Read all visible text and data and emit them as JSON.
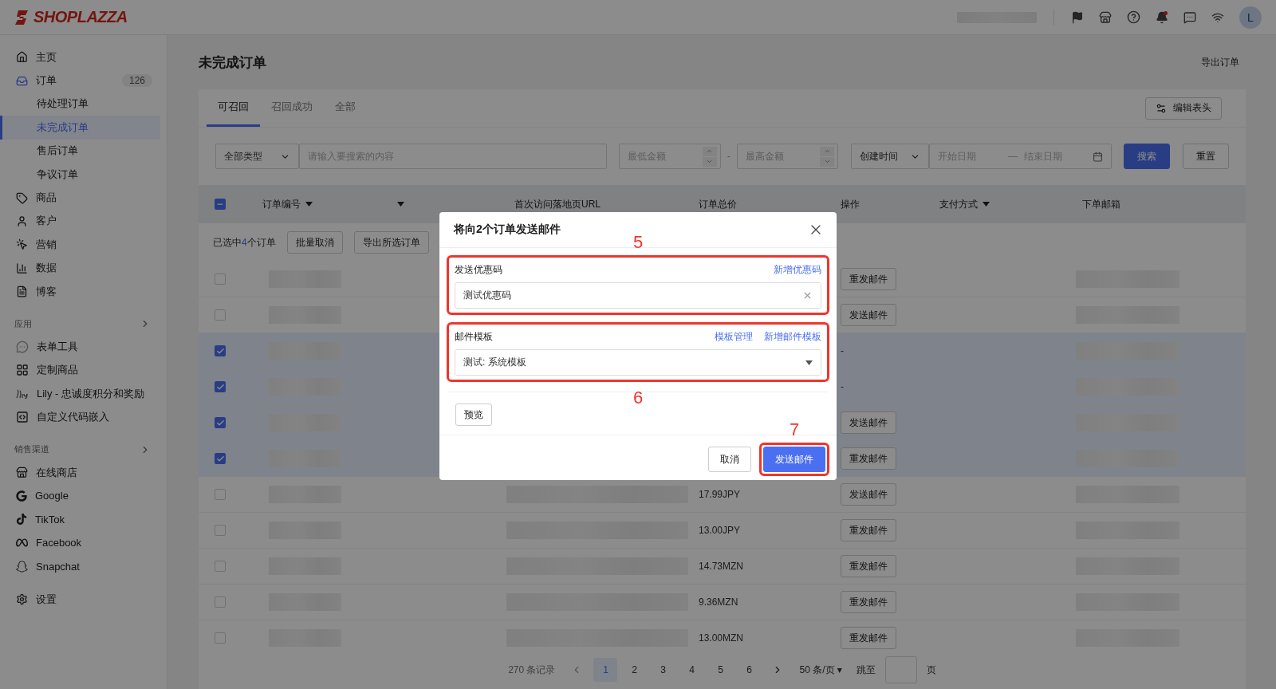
{
  "topbar": {
    "logo": "SHOPLAZZA",
    "avatar": "L"
  },
  "sidebar": {
    "items": [
      {
        "label": "主页",
        "kind": "home",
        "selected": false
      },
      {
        "label": "订单",
        "kind": "orders",
        "badge": "126",
        "selected": false,
        "children": [
          {
            "label": "待处理订单",
            "selected": false
          },
          {
            "label": "未完成订单",
            "selected": true
          },
          {
            "label": "售后订单",
            "selected": false
          },
          {
            "label": "争议订单",
            "selected": false
          }
        ]
      },
      {
        "label": "商品",
        "kind": "products",
        "selected": false
      },
      {
        "label": "客户",
        "kind": "customers",
        "selected": false
      },
      {
        "label": "营销",
        "kind": "marketing",
        "selected": false
      },
      {
        "label": "数据",
        "kind": "analytics",
        "selected": false
      },
      {
        "label": "博客",
        "kind": "blog",
        "selected": false
      }
    ],
    "sections": [
      {
        "title": "应用",
        "items": [
          {
            "label": "表单工具",
            "kind": "form",
            "selected": false
          },
          {
            "label": "定制商品",
            "kind": "custom",
            "selected": false
          },
          {
            "label": "Lily - 忠诚度积分和奖励",
            "kind": "lily",
            "selected": false
          },
          {
            "label": "自定义代码嵌入",
            "kind": "code",
            "selected": false
          }
        ]
      },
      {
        "title": "销售渠道",
        "items": [
          {
            "label": "在线商店",
            "kind": "store",
            "selected": false
          },
          {
            "label": "Google",
            "kind": "google",
            "selected": false
          },
          {
            "label": "TikTok",
            "kind": "tiktok",
            "selected": false
          },
          {
            "label": "Facebook",
            "kind": "facebook",
            "selected": false
          },
          {
            "label": "Snapchat",
            "kind": "snapchat",
            "selected": false
          }
        ]
      }
    ],
    "settings": {
      "label": "设置",
      "kind": "settings",
      "selected": false
    }
  },
  "page": {
    "title": "未完成订单",
    "export_link": "导出订单"
  },
  "tabs": [
    {
      "label": "可召回",
      "selected": true
    },
    {
      "label": "召回成功",
      "selected": false
    },
    {
      "label": "全部",
      "selected": false
    }
  ],
  "edit_columns_button": "编辑表头",
  "filters": {
    "type_select": "全部类型",
    "search_placeholder": "请输入要搜索的内容",
    "min_amount_placeholder": "最低金额",
    "range_separator": "-",
    "max_amount_placeholder": "最高金额",
    "date_type_select": "创建时间",
    "start_date_placeholder": "开始日期",
    "date_separator": "—",
    "end_date_placeholder": "结束日期",
    "search_button": "搜索",
    "reset_button": "重置"
  },
  "table": {
    "indeterminate": true,
    "columns": [
      {
        "label": "订单编号",
        "filter": true
      },
      {
        "filter": true
      },
      {
        "label": "首次访问落地页URL"
      },
      {
        "label": "订单总价"
      },
      {
        "label": "操作"
      },
      {
        "label": "支付方式",
        "filter": true
      },
      {
        "label": "下单邮箱"
      }
    ],
    "selection": {
      "prefix": "已选中",
      "count": "4",
      "suffix": "个订单",
      "buttons": [
        "批量取消",
        "导出所选订单"
      ]
    },
    "rows": [
      {
        "selected": false,
        "action": {
          "kind": "button",
          "label": "重发邮件"
        }
      },
      {
        "selected": false,
        "action": {
          "kind": "button",
          "label": "发送邮件"
        }
      },
      {
        "selected": true,
        "action": {
          "kind": "text",
          "label": "-"
        }
      },
      {
        "selected": true,
        "action": {
          "kind": "text",
          "label": "-"
        }
      },
      {
        "selected": true,
        "action": {
          "kind": "button",
          "label": "发送邮件"
        }
      },
      {
        "selected": true,
        "action": {
          "kind": "button",
          "label": "重发邮件"
        }
      },
      {
        "selected": false,
        "total": "17.99JPY",
        "action": {
          "kind": "button",
          "label": "发送邮件"
        }
      },
      {
        "selected": false,
        "total": "13.00JPY",
        "action": {
          "kind": "button",
          "label": "重发邮件"
        }
      },
      {
        "selected": false,
        "total": "14.73MZN",
        "action": {
          "kind": "button",
          "label": "重发邮件"
        }
      },
      {
        "selected": false,
        "total": "9.36MZN",
        "action": {
          "kind": "button",
          "label": "重发邮件"
        }
      },
      {
        "selected": false,
        "total": "13.00MZN",
        "action": {
          "kind": "button",
          "label": "重发邮件"
        }
      }
    ]
  },
  "pagination": {
    "total": "270 条记录",
    "pages": [
      {
        "label": "1",
        "selected": true
      },
      {
        "label": "2",
        "selected": false
      },
      {
        "label": "3",
        "selected": false
      },
      {
        "label": "4",
        "selected": false
      },
      {
        "label": "5",
        "selected": false
      },
      {
        "label": "6",
        "selected": false
      }
    ],
    "page_size": "50 条/页",
    "page_size_caret": "▾",
    "jump_label": "跳至",
    "page_suffix": "页"
  },
  "modal": {
    "title": "将向2个订单发送邮件",
    "sections": [
      {
        "kind": "coupon",
        "label": "发送优惠码",
        "annotation": "5",
        "links": [
          "新增优惠码"
        ],
        "value": "测试优惠码"
      },
      {
        "kind": "template",
        "label": "邮件模板",
        "annotation": "6",
        "links": [
          "模板管理",
          "新增邮件模板"
        ],
        "value": "测试: 系统模板"
      }
    ],
    "preview_button": "预览",
    "cancel_button": "取消",
    "submit_button": {
      "label": "发送邮件",
      "annotation": "7"
    }
  }
}
